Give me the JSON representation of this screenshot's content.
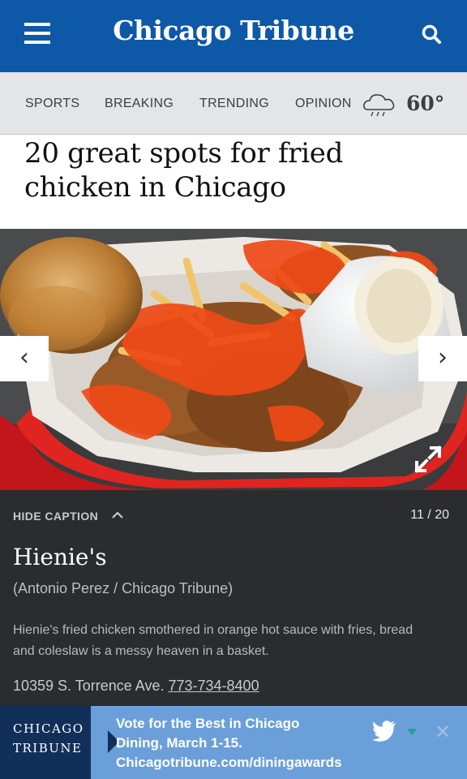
{
  "header": {
    "logo": "Chicago Tribune",
    "menu_icon": "hamburger-menu-icon",
    "search_icon": "search-icon",
    "background_color": "#0e58a8"
  },
  "nav": {
    "items": [
      "SPORTS",
      "BREAKING",
      "TRENDING",
      "OPINION"
    ],
    "weather_icon": "rain-cloud-icon",
    "temperature": "60°"
  },
  "article": {
    "headline": "20 great spots for fried chicken in Chicago"
  },
  "gallery": {
    "prev_label": "‹",
    "next_label": "›",
    "expand_icon": "expand-arrows-icon",
    "hide_caption": "HIDE CAPTION",
    "counter": "11 / 20",
    "caption_title": "Hienie's",
    "credit": "(Antonio Perez / Chicago Tribune)",
    "description": "Hienie's fried chicken smothered in orange hot sauce with fries, bread and coleslaw is a messy heaven in a basket.",
    "address": "10359 S. Torrence Ave.",
    "phone": "773-734-8400"
  },
  "ad": {
    "brand_line1": "CHICAGO",
    "brand_line2": "TRIBUNE",
    "line1": "Vote for the Best in Chicago",
    "line2": "Dining, March 1-15.",
    "line3": "Chicagotribune.com/diningawards",
    "twitter_icon": "twitter-bird-icon",
    "close_label": "✕"
  }
}
